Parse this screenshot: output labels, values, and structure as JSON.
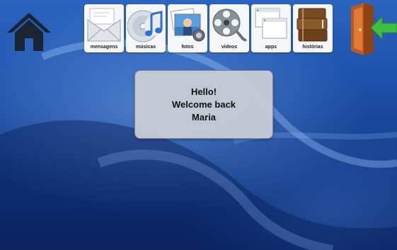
{
  "top_bar": {
    "apps": [
      {
        "label": "mensagens",
        "icon": "mail-envelope-icon"
      },
      {
        "label": "músicas",
        "icon": "music-cd-icon"
      },
      {
        "label": "fotos",
        "icon": "photos-icon"
      },
      {
        "label": "vídeos",
        "icon": "film-reel-icon"
      },
      {
        "label": "apps",
        "icon": "app-windows-icon"
      },
      {
        "label": "histórias",
        "icon": "books-icon"
      }
    ],
    "home_icon": "home-icon",
    "exit_icon": "exit-door-icon"
  },
  "welcome": {
    "line1": "Hello!",
    "line2": "Welcome back",
    "line3": "Maria"
  },
  "colors": {
    "background": "#1d4fa6",
    "dialog": "#c8ccd4",
    "home": "#1a2433",
    "exit_arrow": "#3fbf3f",
    "door": "#c8692a"
  }
}
